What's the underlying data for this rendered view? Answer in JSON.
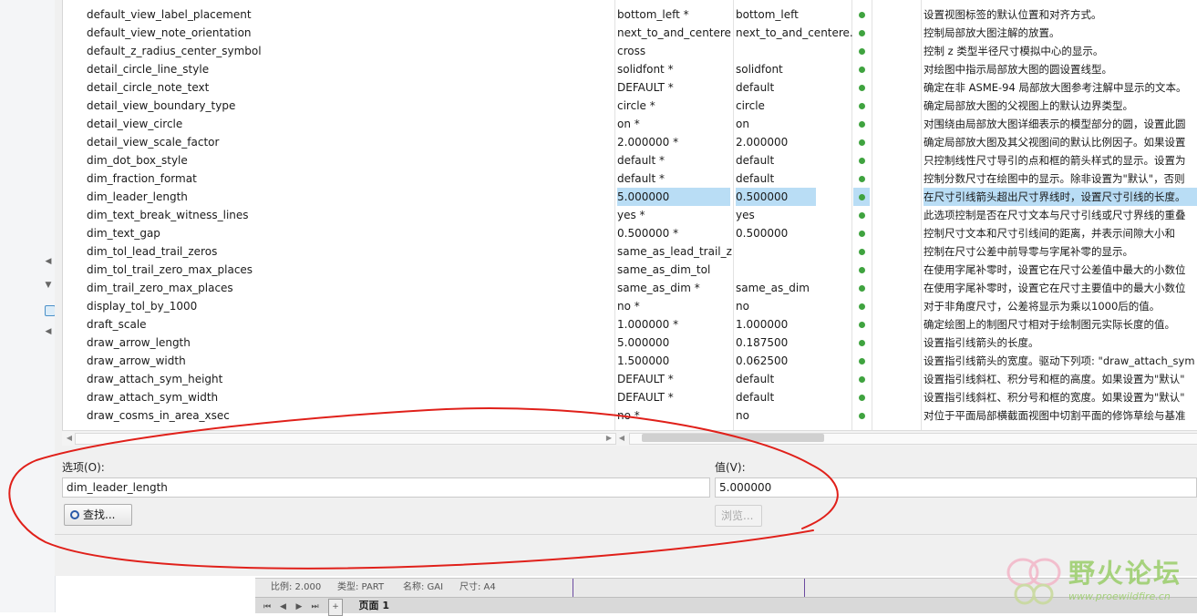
{
  "options": [
    {
      "name": "default_view_label_placement",
      "value": "bottom_left *",
      "default": "bottom_left",
      "status": "dot",
      "desc": "设置视图标签的默认位置和对齐方式。"
    },
    {
      "name": "default_view_note_orientation",
      "value": "next_to_and_centere...",
      "default": "next_to_and_centere...",
      "status": "dot",
      "desc": "控制局部放大图注解的放置。"
    },
    {
      "name": "default_z_radius_center_symbol",
      "value": "cross",
      "default": "",
      "status": "dot",
      "desc": "控制 z 类型半径尺寸模拟中心的显示。"
    },
    {
      "name": "detail_circle_line_style",
      "value": "solidfont *",
      "default": "solidfont",
      "status": "dot",
      "desc": "对绘图中指示局部放大图的圆设置线型。"
    },
    {
      "name": "detail_circle_note_text",
      "value": "DEFAULT *",
      "default": "default",
      "status": "dot",
      "desc": "确定在非 ASME-94 局部放大图参考注解中显示的文本。"
    },
    {
      "name": "detail_view_boundary_type",
      "value": "circle *",
      "default": "circle",
      "status": "dot",
      "desc": "确定局部放大图的父视图上的默认边界类型。"
    },
    {
      "name": "detail_view_circle",
      "value": "on *",
      "default": "on",
      "status": "dot",
      "desc": "对围绕由局部放大图详细表示的模型部分的圆，设置此圆"
    },
    {
      "name": "detail_view_scale_factor",
      "value": "2.000000 *",
      "default": "2.000000",
      "status": "dot",
      "desc": "确定局部放大图及其父视图间的默认比例因子。如果设置"
    },
    {
      "name": "dim_dot_box_style",
      "value": "default *",
      "default": "default",
      "status": "dot",
      "desc": "只控制线性尺寸导引的点和框的箭头样式的显示。设置为"
    },
    {
      "name": "dim_fraction_format",
      "value": "default *",
      "default": "default",
      "status": "dot",
      "desc": "控制分数尺寸在绘图中的显示。除非设置为\"默认\"，否则"
    },
    {
      "name": "dim_leader_length",
      "value": "5.000000",
      "default": "0.500000",
      "status": "dot",
      "desc": "在尺寸引线箭头超出尺寸界线时，设置尺寸引线的长度。",
      "selected": true
    },
    {
      "name": "dim_text_break_witness_lines",
      "value": "yes *",
      "default": "yes",
      "status": "dot",
      "desc": "此选项控制是否在尺寸文本与尺寸引线或尺寸界线的重叠"
    },
    {
      "name": "dim_text_gap",
      "value": "0.500000 *",
      "default": "0.500000",
      "status": "dot",
      "desc": "控制尺寸文本和尺寸引线间的距离，并表示间隙大小和"
    },
    {
      "name": "dim_tol_lead_trail_zeros",
      "value": "same_as_lead_trail_z...",
      "default": "",
      "status": "dot",
      "desc": "控制在尺寸公差中前导零与字尾补零的显示。"
    },
    {
      "name": "dim_tol_trail_zero_max_places",
      "value": "same_as_dim_tol",
      "default": "",
      "status": "dot",
      "desc": "在使用字尾补零时，设置它在尺寸公差值中最大的小数位"
    },
    {
      "name": "dim_trail_zero_max_places",
      "value": "same_as_dim *",
      "default": "same_as_dim",
      "status": "dot",
      "desc": "在使用字尾补零时，设置它在尺寸主要值中的最大小数位"
    },
    {
      "name": "display_tol_by_1000",
      "value": "no *",
      "default": "no",
      "status": "dot",
      "desc": "对于非角度尺寸，公差将显示为乘以1000后的值。"
    },
    {
      "name": "draft_scale",
      "value": "1.000000 *",
      "default": "1.000000",
      "status": "dot",
      "desc": "确定绘图上的制图尺寸相对于绘制图元实际长度的值。"
    },
    {
      "name": "draw_arrow_length",
      "value": "5.000000",
      "default": "0.187500",
      "status": "dot",
      "desc": "设置指引线箭头的长度。"
    },
    {
      "name": "draw_arrow_width",
      "value": "1.500000",
      "default": "0.062500",
      "status": "dot",
      "desc": "设置指引线箭头的宽度。驱动下列项: \"draw_attach_sym"
    },
    {
      "name": "draw_attach_sym_height",
      "value": "DEFAULT *",
      "default": "default",
      "status": "dot",
      "desc": "设置指引线斜杠、积分号和框的高度。如果设置为\"默认\""
    },
    {
      "name": "draw_attach_sym_width",
      "value": "DEFAULT *",
      "default": "default",
      "status": "dot",
      "desc": "设置指引线斜杠、积分号和框的宽度。如果设置为\"默认\""
    },
    {
      "name": "draw_cosms_in_area_xsec",
      "value": "no *",
      "default": "no",
      "status": "dot",
      "desc": "对位于平面局部横截面视图中切割平面的修饰草绘与基准"
    }
  ],
  "editor": {
    "option_label": "选项(O):",
    "option_value": "dim_leader_length",
    "value_label": "值(V):",
    "value_value": "5.000000",
    "find_button": "查找...",
    "browse_button": "浏览..."
  },
  "statusbar": {
    "scale": "比例: 2.000",
    "type": "类型: PART",
    "name": "名称: GAI",
    "size": "尺寸: A4",
    "page_tab": "页面 1"
  },
  "watermark": {
    "title": "野火论坛",
    "url": "www.proewildfire.cn"
  },
  "colors": {
    "selection": "#b9ddf5",
    "status_dot": "#3fa33f",
    "annotation": "#e0201a"
  }
}
